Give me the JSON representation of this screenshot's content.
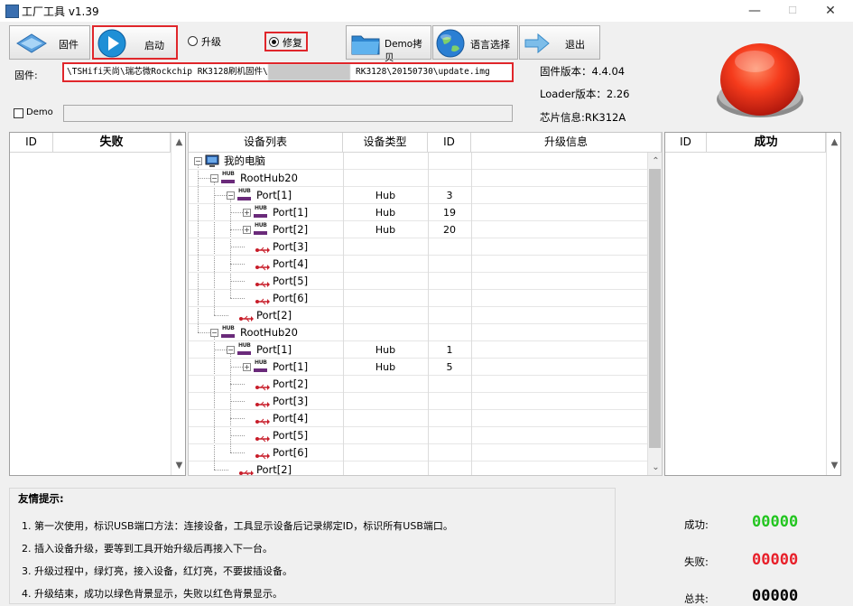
{
  "window": {
    "title": "工厂工具 v1.39",
    "min": "—",
    "max": "☐",
    "close": "✕"
  },
  "toolbar": {
    "firmware_label": "固件",
    "start_label": "启动",
    "upgrade_label": "升级",
    "repair_label": "修复",
    "demo_copy_label": "Demo拷贝",
    "language_label": "语言选择",
    "exit_label": "退出"
  },
  "firmware": {
    "label": "固件:",
    "path_start": "\\TSHifi天尚\\瑞芯微Rockchip RK3128刷机固件\\",
    "path_end": " RK3128\\20150730\\update.img"
  },
  "info": {
    "fw_version": "固件版本：4.4.04",
    "loader_version": "Loader版本：2.26",
    "chip_info": "芯片信息:RK312A"
  },
  "demo": {
    "label": "Demo"
  },
  "fail_panel": {
    "col_id": "ID",
    "col_title": "失败"
  },
  "success_panel": {
    "col_id": "ID",
    "col_title": "成功"
  },
  "device_table": {
    "headers": {
      "tree": "设备列表",
      "type": "设备类型",
      "id": "ID",
      "info": "升级信息"
    },
    "rows": [
      {
        "name": "我的电脑",
        "type": "",
        "id": ""
      },
      {
        "name": "RootHub20",
        "type": "",
        "id": ""
      },
      {
        "name": "Port[1]",
        "type": "Hub",
        "id": "3"
      },
      {
        "name": "Port[1]",
        "type": "Hub",
        "id": "19"
      },
      {
        "name": "Port[2]",
        "type": "Hub",
        "id": "20"
      },
      {
        "name": "Port[3]",
        "type": "",
        "id": ""
      },
      {
        "name": "Port[4]",
        "type": "",
        "id": ""
      },
      {
        "name": "Port[5]",
        "type": "",
        "id": ""
      },
      {
        "name": "Port[6]",
        "type": "",
        "id": ""
      },
      {
        "name": "Port[2]",
        "type": "",
        "id": ""
      },
      {
        "name": "RootHub20",
        "type": "",
        "id": ""
      },
      {
        "name": "Port[1]",
        "type": "Hub",
        "id": "1"
      },
      {
        "name": "Port[1]",
        "type": "Hub",
        "id": "5"
      },
      {
        "name": "Port[2]",
        "type": "",
        "id": ""
      },
      {
        "name": "Port[3]",
        "type": "",
        "id": ""
      },
      {
        "name": "Port[4]",
        "type": "",
        "id": ""
      },
      {
        "name": "Port[5]",
        "type": "",
        "id": ""
      },
      {
        "name": "Port[6]",
        "type": "",
        "id": ""
      },
      {
        "name": "Port[2]",
        "type": "",
        "id": ""
      }
    ]
  },
  "tips": {
    "title": "友情提示:",
    "items": [
      "1. 第一次使用，标识USB端口方法：连接设备，工具显示设备后记录绑定ID，标识所有USB端口。",
      "2. 插入设备升级，要等到工具开始升级后再接入下一台。",
      "3. 升级过程中，绿灯亮，接入设备，红灯亮，不要拔插设备。",
      "4. 升级结束，成功以绿色背景显示，失败以红色背景显示。"
    ]
  },
  "stats": {
    "success_label": "成功:",
    "success_value": "00000",
    "fail_label": "失败:",
    "fail_value": "00000",
    "total_label": "总共:",
    "total_value": "00000"
  },
  "colors": {
    "success": "#22c51f",
    "fail": "#e8202a",
    "highlight": "#e0262b"
  }
}
